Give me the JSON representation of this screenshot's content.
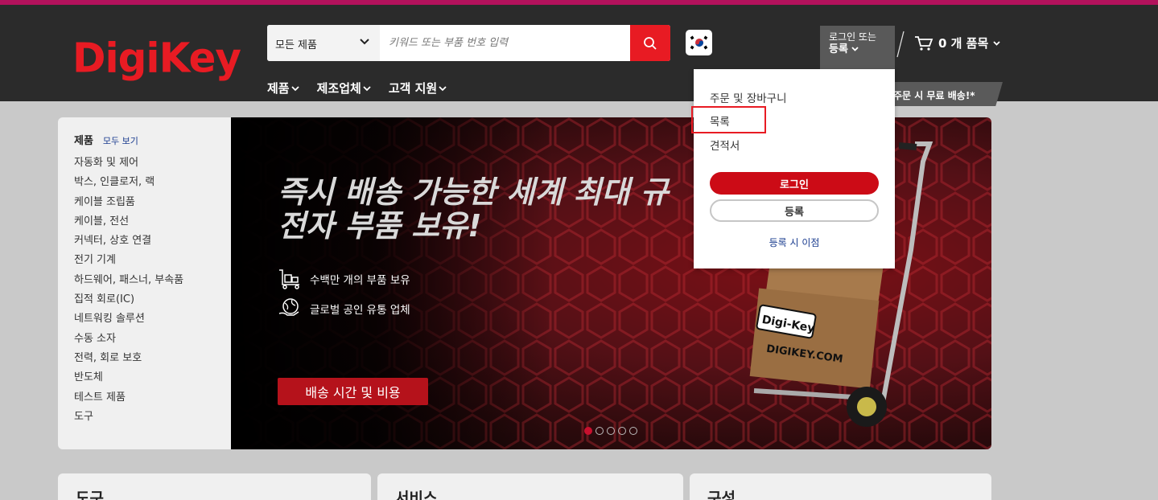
{
  "header": {
    "logo_text": "DigiKey",
    "search": {
      "category_label": "모든 제품",
      "placeholder": "키워드 또는 부품 번호 입력"
    },
    "login_label_line1": "로그인 또는",
    "login_label_line2": "등록",
    "cart_label": "0 개 품목",
    "nav": [
      "제품",
      "제조업체",
      "고객 지원"
    ],
    "promo_text": "주문 시 무료 배송!*"
  },
  "account_dropdown": {
    "items": [
      "주문 및 장바구니",
      "목록",
      "견적서"
    ],
    "login_button": "로그인",
    "register_button": "등록",
    "benefits_link": "등록 시 이점"
  },
  "sidebar": {
    "title": "제품",
    "view_all": "모두 보기",
    "categories": [
      "자동화 및 제어",
      "박스, 인클로저, 랙",
      "케이블 조립품",
      "케이블, 전선",
      "커넥터, 상호 연결",
      "전기 기계",
      "하드웨어, 패스너, 부속품",
      "집적 회로(IC)",
      "네트워킹 솔루션",
      "수동 소자",
      "전력, 회로 보호",
      "반도체",
      "테스트 제품",
      "도구"
    ]
  },
  "hero": {
    "headline_line1": "즉시 배송 가능한 세계 최대 규",
    "headline_line2": "전자 부품 보유!",
    "feature1": "수백만 개의 부품 보유",
    "feature2": "글로벌 공인 유통 업체",
    "cta": "배송 시간 및 비용",
    "box_label1": "Digi-Key",
    "box_label2": "DIGIKEY.COM",
    "carousel_active": 1,
    "carousel_count": 5
  },
  "cards": [
    "도구",
    "서비스",
    "구성"
  ],
  "colors": {
    "brand_red": "#e81b23",
    "header_bg": "#2b2b2b",
    "accent_stripe": "#b3125c"
  }
}
